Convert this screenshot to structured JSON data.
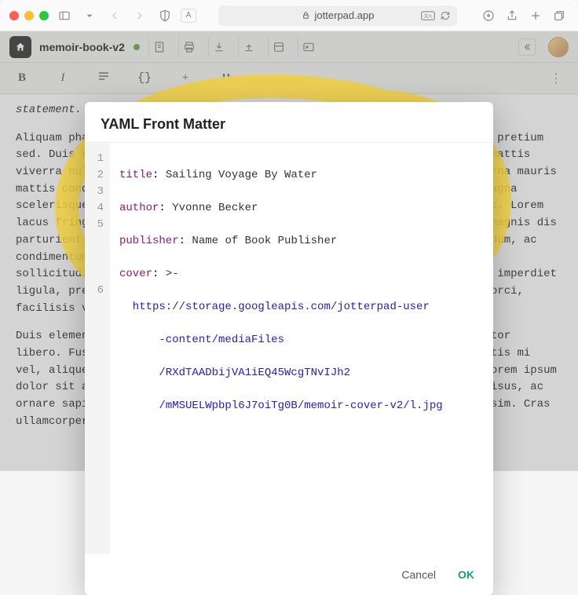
{
  "browser": {
    "url_host": "jotterpad.app"
  },
  "app": {
    "doc_title": "memoir-book-v2"
  },
  "format_bar": {
    "bold": "B",
    "italic": "I",
    "list": "≡",
    "code": "{}",
    "add": "+",
    "quote": "❝",
    "more": "⋮"
  },
  "document": {
    "p0": "statement.",
    "p1": "Aliquam pharetra mauris a nisl malesuada, ac varius leo semper tempor, a pretium sed. Duis vehicula enim in felis consequat posuere. Aenean iaculis quam mattis viverra nulla consectetur aliquet. Ultricies metus at quis a mi. Morbi urna mauris mattis condimentum sed, ornare sed proin. Nec massa vulputate nulla in magna scelerisque ut venenatis lectus. Vestibulum porta tortor, eu euismod nunc. Lorem lacus fringilla, consequat et anon ii. Orci varius natoque penatibus et magnis dis parturient. Nascetur ridiculus mus. Suspendisse tincidunt est eget interdum, ac condimentum donec. Duis et pharetra cursus proin orci, eget sollicitudin sollicitudin velit. Sed at egestas consequat pharetra sit amet. Interdum imperdiet ligula, pretium eu feugiat dolor. Ut suscipit eget dapibus velit varius orci, facilisis velit sed.",
    "p2": "Duis elementum gravida mi tortor, eu aliquam. Duis porttitor sed, et auctor libero. Fusce facilisis quis aliquam est facilisis tempor felis ut lobortis mi vel, aliquet massa. Maecenas consequat elit varius est semper rhoncus. Lorem ipsum dolor sit amet, consectetur adipiscing elit. Vestibulum suscipit magna risus, ac ornare sapien sagittis vel. Mauris porta enim eget nibh imperdiet dignissim. Cras ullamcorper augue non dapibus condimentum. Sed convallis neque"
  },
  "dialog": {
    "title": "YAML Front Matter",
    "cancel": "Cancel",
    "ok": "OK",
    "yaml": {
      "title_key": "title",
      "title_val": " Sailing Voyage By Water",
      "author_key": "author",
      "author_val": " Yvonne Becker",
      "publisher_key": "publisher",
      "publisher_val": " Name of Book Publisher",
      "cover_key": "cover",
      "cover_marker": " >-",
      "cover_url_l1": "  https://storage.googleapis.com/jotterpad-user",
      "cover_url_l2": "      -content/mediaFiles",
      "cover_url_l3": "      /RXdTAADbijVA1iEQ45WcgTNvIJh2",
      "cover_url_l4": "      /mMSUELWpbpl6J7oiTg0B/memoir-cover-v2/l.jpg"
    },
    "line_numbers": [
      "1",
      "2",
      "3",
      "4",
      "5",
      "6"
    ]
  }
}
